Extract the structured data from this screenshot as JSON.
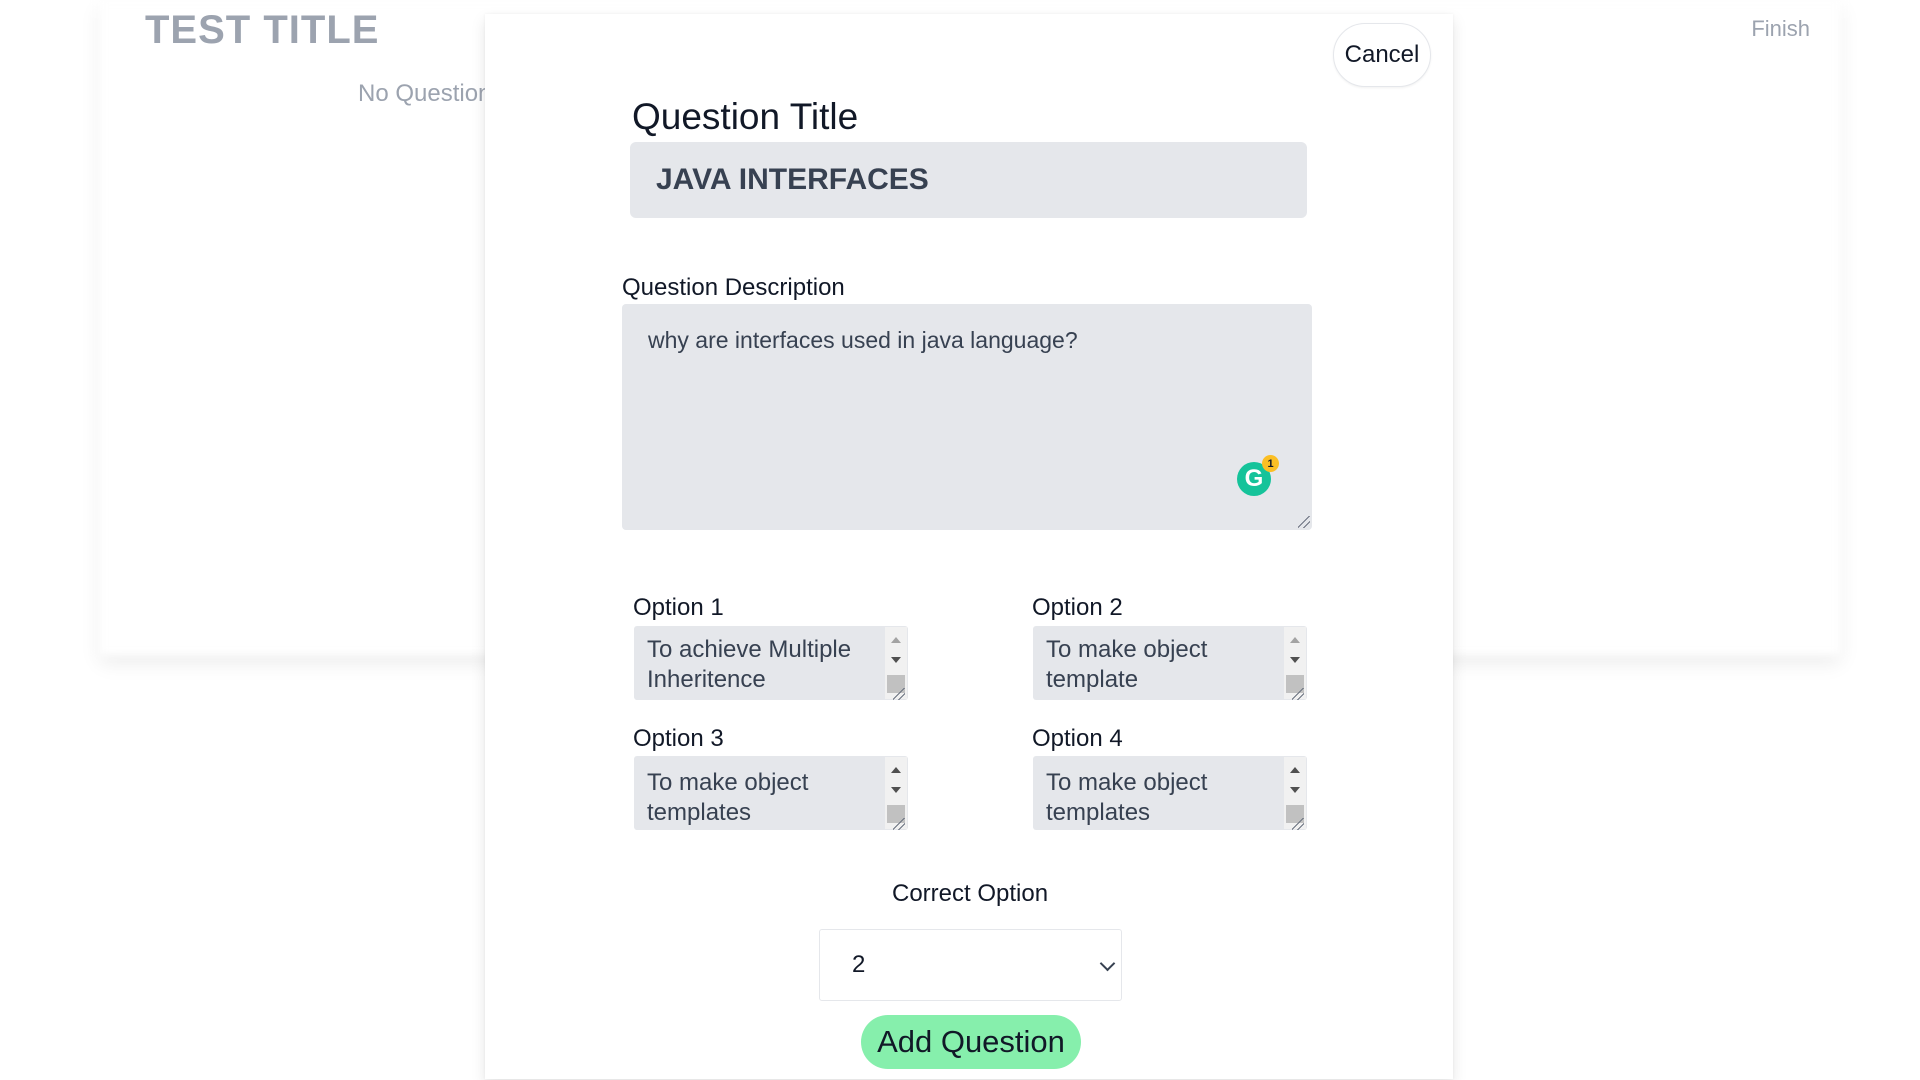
{
  "background": {
    "title": "TEST TITLE",
    "empty_text": "No Questions",
    "finish_label": "Finish"
  },
  "modal": {
    "cancel_label": "Cancel",
    "title_label": "Question Title",
    "title_value": "JAVA INTERFACES",
    "description_label": "Question Description",
    "description_value": "why are interfaces used in java language?",
    "grammarly_icon": "G",
    "grammarly_count": "1",
    "options": [
      {
        "label": "Option 1",
        "value": "To achieve Multiple Inheritence"
      },
      {
        "label": "Option 2",
        "value": "To make object template"
      },
      {
        "label": "Option 3",
        "value": "To make object templates"
      },
      {
        "label": "Option 4",
        "value": "To make object templates"
      }
    ],
    "correct_label": "Correct Option",
    "correct_value": "2",
    "add_label": "Add Question"
  },
  "colors": {
    "field_bg": "#e5e7eb",
    "add_button": "#86efac",
    "grammarly": "#15c39a"
  }
}
